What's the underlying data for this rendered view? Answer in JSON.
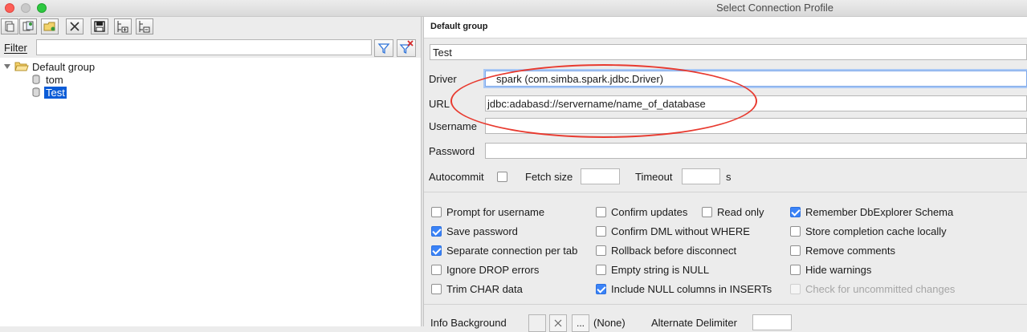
{
  "window": {
    "title": "Select Connection Profile"
  },
  "toolbar": {
    "icons": [
      "new-profile-icon",
      "copy-profile-icon",
      "new-folder-icon",
      "delete-icon",
      "save-icon",
      "expand-all-icon",
      "collapse-all-icon"
    ]
  },
  "filter": {
    "label": "Filter",
    "value": "",
    "placeholder": ""
  },
  "tree": {
    "group": "Default group",
    "items": [
      {
        "label": "tom",
        "selected": false
      },
      {
        "label": "Test",
        "selected": true
      }
    ]
  },
  "profile": {
    "group_header": "Default group",
    "name": "Test",
    "driver_label": "Driver",
    "driver_value": "spark (com.simba.spark.jdbc.Driver)",
    "url_label": "URL",
    "url_value": "jdbc:adabasd://servername/name_of_database",
    "username_label": "Username",
    "username_value": "",
    "password_label": "Password",
    "password_value": "",
    "autocommit_label": "Autocommit",
    "fetchsize_label": "Fetch size",
    "fetchsize_value": "",
    "timeout_label": "Timeout",
    "timeout_value": "",
    "timeout_unit": "s"
  },
  "options": {
    "col1": [
      {
        "label": "Prompt for username",
        "checked": false
      },
      {
        "label": "Save password",
        "checked": true
      },
      {
        "label": "Separate connection per tab",
        "checked": true
      },
      {
        "label": "Ignore DROP errors",
        "checked": false
      },
      {
        "label": "Trim CHAR data",
        "checked": false
      }
    ],
    "col2": [
      {
        "label": "Confirm updates",
        "checked": false
      },
      {
        "label": "Confirm DML without WHERE",
        "checked": false
      },
      {
        "label": "Rollback before disconnect",
        "checked": false
      },
      {
        "label": "Empty string is NULL",
        "checked": false
      },
      {
        "label": "Include NULL columns in INSERTs",
        "checked": true
      }
    ],
    "readonly": {
      "label": "Read only",
      "checked": false
    },
    "col3": [
      {
        "label": "Remember DbExplorer Schema",
        "checked": true
      },
      {
        "label": "Store completion cache locally",
        "checked": false
      },
      {
        "label": "Remove comments",
        "checked": false
      },
      {
        "label": "Hide warnings",
        "checked": false
      },
      {
        "label": "Check for uncommitted changes",
        "checked": false,
        "disabled": true
      }
    ]
  },
  "bottom": {
    "info_bg_label": "Info Background",
    "info_bg_value": "(None)",
    "choose_label": "...",
    "alt_delim_label": "Alternate Delimiter",
    "alt_delim_value": ""
  },
  "colors": {
    "selection": "#0b5cd7",
    "checkbox_on": "#3b83f7",
    "annotation": "#e83a2f"
  }
}
